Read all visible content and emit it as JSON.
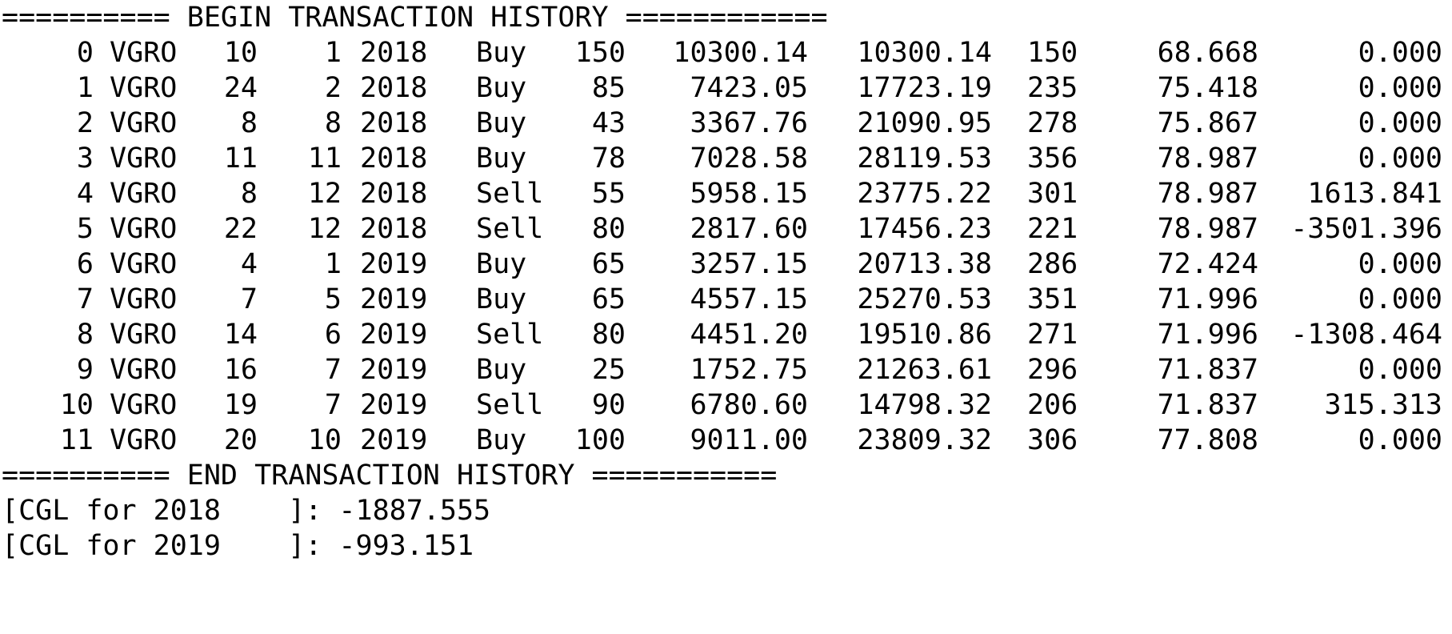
{
  "header": {
    "begin_banner": "========== BEGIN TRANSACTION HISTORY ============"
  },
  "rows": [
    {
      "idx": "0",
      "symbol": "VGRO",
      "day": "10",
      "month": "1",
      "year": "2018",
      "action": "Buy",
      "qty": "150",
      "amount": "10300.14",
      "cumulative": "10300.14",
      "shares": "150",
      "acb": "68.668",
      "cgl": "0.000"
    },
    {
      "idx": "1",
      "symbol": "VGRO",
      "day": "24",
      "month": "2",
      "year": "2018",
      "action": "Buy",
      "qty": "85",
      "amount": "7423.05",
      "cumulative": "17723.19",
      "shares": "235",
      "acb": "75.418",
      "cgl": "0.000"
    },
    {
      "idx": "2",
      "symbol": "VGRO",
      "day": "8",
      "month": "8",
      "year": "2018",
      "action": "Buy",
      "qty": "43",
      "amount": "3367.76",
      "cumulative": "21090.95",
      "shares": "278",
      "acb": "75.867",
      "cgl": "0.000"
    },
    {
      "idx": "3",
      "symbol": "VGRO",
      "day": "11",
      "month": "11",
      "year": "2018",
      "action": "Buy",
      "qty": "78",
      "amount": "7028.58",
      "cumulative": "28119.53",
      "shares": "356",
      "acb": "78.987",
      "cgl": "0.000"
    },
    {
      "idx": "4",
      "symbol": "VGRO",
      "day": "8",
      "month": "12",
      "year": "2018",
      "action": "Sell",
      "qty": "55",
      "amount": "5958.15",
      "cumulative": "23775.22",
      "shares": "301",
      "acb": "78.987",
      "cgl": "1613.841"
    },
    {
      "idx": "5",
      "symbol": "VGRO",
      "day": "22",
      "month": "12",
      "year": "2018",
      "action": "Sell",
      "qty": "80",
      "amount": "2817.60",
      "cumulative": "17456.23",
      "shares": "221",
      "acb": "78.987",
      "cgl": "-3501.396"
    },
    {
      "idx": "6",
      "symbol": "VGRO",
      "day": "4",
      "month": "1",
      "year": "2019",
      "action": "Buy",
      "qty": "65",
      "amount": "3257.15",
      "cumulative": "20713.38",
      "shares": "286",
      "acb": "72.424",
      "cgl": "0.000"
    },
    {
      "idx": "7",
      "symbol": "VGRO",
      "day": "7",
      "month": "5",
      "year": "2019",
      "action": "Buy",
      "qty": "65",
      "amount": "4557.15",
      "cumulative": "25270.53",
      "shares": "351",
      "acb": "71.996",
      "cgl": "0.000"
    },
    {
      "idx": "8",
      "symbol": "VGRO",
      "day": "14",
      "month": "6",
      "year": "2019",
      "action": "Sell",
      "qty": "80",
      "amount": "4451.20",
      "cumulative": "19510.86",
      "shares": "271",
      "acb": "71.996",
      "cgl": "-1308.464"
    },
    {
      "idx": "9",
      "symbol": "VGRO",
      "day": "16",
      "month": "7",
      "year": "2019",
      "action": "Buy",
      "qty": "25",
      "amount": "1752.75",
      "cumulative": "21263.61",
      "shares": "296",
      "acb": "71.837",
      "cgl": "0.000"
    },
    {
      "idx": "10",
      "symbol": "VGRO",
      "day": "19",
      "month": "7",
      "year": "2019",
      "action": "Sell",
      "qty": "90",
      "amount": "6780.60",
      "cumulative": "14798.32",
      "shares": "206",
      "acb": "71.837",
      "cgl": "315.313"
    },
    {
      "idx": "11",
      "symbol": "VGRO",
      "day": "20",
      "month": "10",
      "year": "2019",
      "action": "Buy",
      "qty": "100",
      "amount": "9011.00",
      "cumulative": "23809.32",
      "shares": "306",
      "acb": "77.808",
      "cgl": "0.000"
    }
  ],
  "footer": {
    "end_banner": "========== END TRANSACTION HISTORY ===========",
    "summaries": [
      "[CGL for 2018    ]: -1887.555",
      "[CGL for 2019    ]: -993.151"
    ]
  }
}
